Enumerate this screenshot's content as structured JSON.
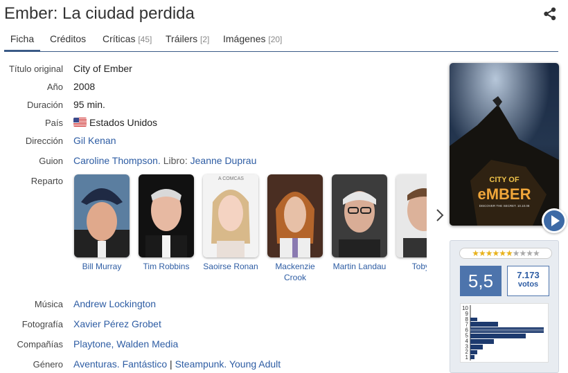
{
  "title": "Ember: La ciudad perdida",
  "tabs": [
    {
      "label": "Ficha",
      "count": ""
    },
    {
      "label": "Créditos",
      "count": ""
    },
    {
      "label": "Críticas",
      "count": "[45]"
    },
    {
      "label": "Tráilers",
      "count": "[2]"
    },
    {
      "label": "Imágenes",
      "count": "[20]"
    }
  ],
  "fields": {
    "original_title": {
      "label": "Título original",
      "value": "City of Ember"
    },
    "year": {
      "label": "Año",
      "value": "2008"
    },
    "duration": {
      "label": "Duración",
      "value": "95 min."
    },
    "country": {
      "label": "País",
      "value": "Estados Unidos"
    },
    "direction": {
      "label": "Dirección",
      "value": "Gil Kenan"
    },
    "screenplay": {
      "label": "Guion",
      "writer": "Caroline Thompson.",
      "book_prefix": " Libro: ",
      "book": "Jeanne Duprau"
    },
    "cast_label": "Reparto",
    "music": {
      "label": "Música",
      "value": "Andrew Lockington"
    },
    "photography": {
      "label": "Fotografía",
      "value": "Xavier Pérez Grobet"
    },
    "companies": {
      "label": "Compañías",
      "value": "Playtone, Walden Media"
    },
    "genre": {
      "label": "Género",
      "g1": "Aventuras.",
      "g2": "Fantástico",
      "sep": "|",
      "g3": "Steampunk.",
      "g4": "Young Adult"
    }
  },
  "cast": [
    {
      "name": "Bill Murray"
    },
    {
      "name": "Tim Robbins"
    },
    {
      "name": "Saoirse Ronan"
    },
    {
      "name": "Mackenzie Crook"
    },
    {
      "name": "Martin Landau"
    },
    {
      "name": "Toby J"
    }
  ],
  "poster": {
    "title_line1": "CITY OF",
    "title_line2": "eMBER",
    "tagline": "DISCOVER THE SECRET. 10.10.08"
  },
  "rating": {
    "stars": "★★★★★★★★★★",
    "filled_stars": 5.5,
    "score": "5,5",
    "votes_count": "7.173",
    "votes_label": "votos",
    "histogram_labels": [
      "10",
      "9",
      "8",
      "7",
      "6",
      "5",
      "4",
      "3",
      "2",
      "1"
    ]
  },
  "colors": {
    "accent": "#3a5a86",
    "link": "#2d5ca3",
    "score_bg": "#4d74ac"
  }
}
